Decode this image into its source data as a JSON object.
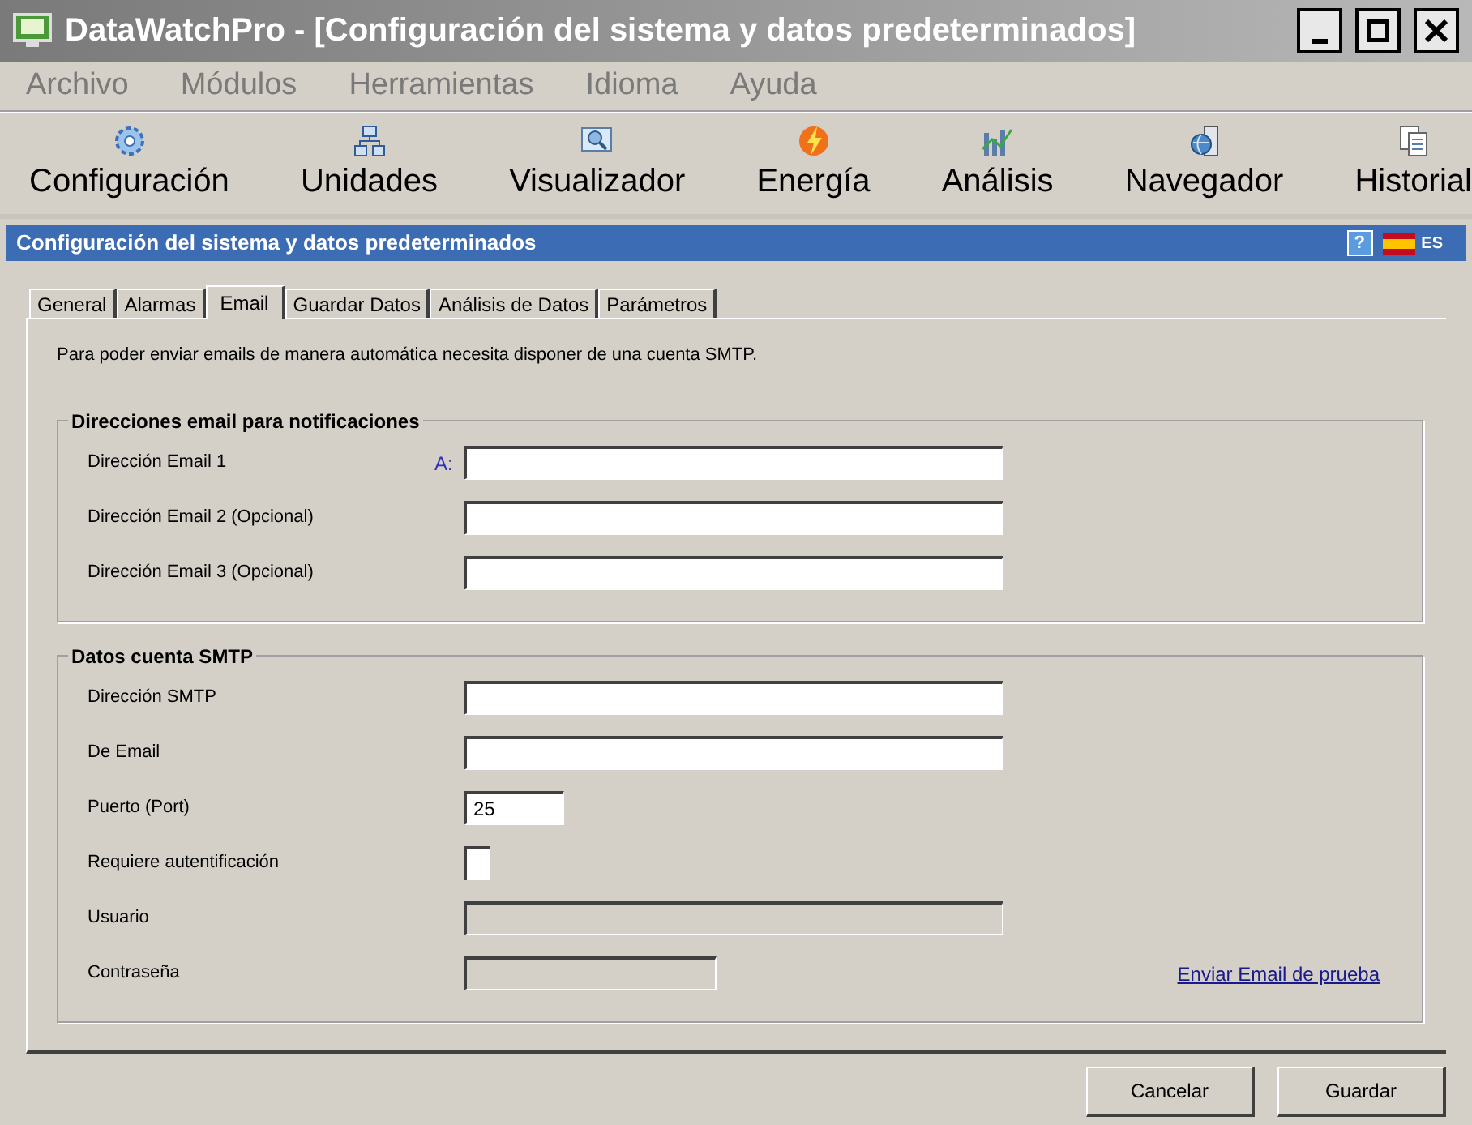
{
  "window": {
    "title": "DataWatchPro - [Configuración del sistema y datos predeterminados]"
  },
  "menu": [
    "Archivo",
    "Módulos",
    "Herramientas",
    "Idioma",
    "Ayuda"
  ],
  "toolbar": [
    {
      "label": "Configuración",
      "kind": "gear"
    },
    {
      "label": "Unidades",
      "kind": "network"
    },
    {
      "label": "Visualizador",
      "kind": "viewer"
    },
    {
      "label": "Energía",
      "kind": "energy"
    },
    {
      "label": "Análisis",
      "kind": "chart"
    },
    {
      "label": "Navegador",
      "kind": "globe"
    },
    {
      "label": "Historial",
      "kind": "document"
    }
  ],
  "header": {
    "title": "Configuración del sistema y datos predeterminados",
    "help": "?",
    "language": "ES"
  },
  "tabs": [
    {
      "label": "General",
      "selected": false
    },
    {
      "label": "Alarmas",
      "selected": false
    },
    {
      "label": "Email",
      "selected": true
    },
    {
      "label": "Guardar Datos",
      "selected": false
    },
    {
      "label": "Análisis de Datos",
      "selected": false
    },
    {
      "label": "Parámetros",
      "selected": false
    }
  ],
  "intro": "Para poder enviar emails de manera automática necesita disponer de una cuenta SMTP.",
  "groups": [
    {
      "title": "Direcciones email para notificaciones",
      "rows": [
        {
          "label": "Dirección Email 1",
          "kind": "text",
          "prefix": "A:",
          "disabled": false
        },
        {
          "label": "Dirección Email 2 (Opcional)",
          "kind": "text",
          "disabled": false
        },
        {
          "label": "Dirección Email 3 (Opcional)",
          "kind": "text",
          "disabled": false
        }
      ]
    },
    {
      "title": "Datos cuenta SMTP",
      "rows": [
        {
          "label": "Dirección SMTP",
          "kind": "text",
          "disabled": false
        },
        {
          "label": "De Email",
          "kind": "text",
          "disabled": false
        },
        {
          "label": "Puerto (Port)",
          "kind": "number",
          "value": "25",
          "disabled": false
        },
        {
          "label": "Requiere autentificación",
          "kind": "checkbox",
          "checked": false
        },
        {
          "label": "Usuario",
          "kind": "text",
          "disabled": true
        },
        {
          "label": "Contraseña",
          "kind": "password",
          "disabled": true,
          "link": "Enviar Email de prueba"
        }
      ]
    }
  ],
  "buttons": [
    "Cancelar",
    "Guardar"
  ]
}
